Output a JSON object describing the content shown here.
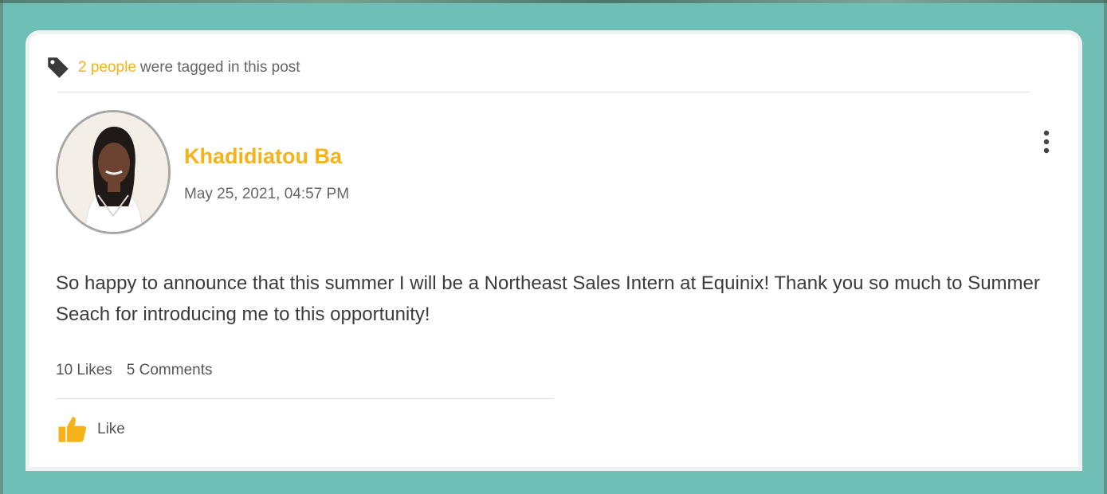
{
  "tagged": {
    "count_text": "2 people",
    "suffix_text": "were tagged in this post"
  },
  "post": {
    "author_name": "Khadidiatou Ba",
    "date": "May 25, 2021, 04:57 PM",
    "body": "So happy to announce that this summer I will be a Northeast Sales Intern at Equinix! Thank you so much to Summer Seach for introducing me to this opportunity!"
  },
  "stats": {
    "likes": "10 Likes",
    "comments": "5 Comments"
  },
  "actions": {
    "like_label": "Like"
  },
  "icons": {
    "tag": "tag-icon",
    "more": "more-vertical-icon",
    "like": "thumbs-up-icon"
  },
  "colors": {
    "accent": "#f6b21b",
    "frame": "#6fbfb6",
    "text": "#3b3b3b"
  }
}
